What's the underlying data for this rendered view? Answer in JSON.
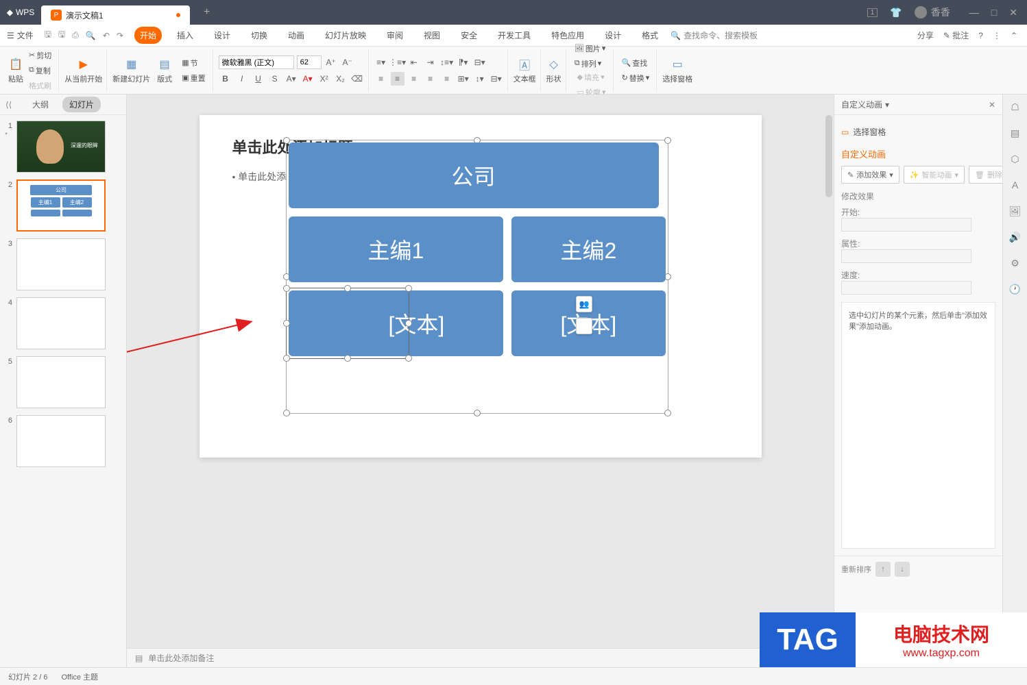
{
  "titlebar": {
    "app_name": "WPS",
    "tab_title": "演示文稿1",
    "user_name": "香香"
  },
  "menubar": {
    "file": "文件",
    "tabs": [
      "开始",
      "插入",
      "设计",
      "切换",
      "动画",
      "幻灯片放映",
      "审阅",
      "视图",
      "安全",
      "开发工具",
      "特色应用",
      "设计",
      "格式"
    ],
    "search_placeholder": "查找命令、搜索模板",
    "share": "分享",
    "comment": "批注"
  },
  "ribbon": {
    "paste": "粘贴",
    "cut": "剪切",
    "copy": "复制",
    "format_painter": "格式刷",
    "from_current": "从当前开始",
    "new_slide": "新建幻灯片",
    "layout": "版式",
    "section": "节",
    "reset": "重置",
    "font_name": "微软雅黑 (正文)",
    "font_size": "62",
    "textbox": "文本框",
    "shape": "形状",
    "picture": "图片",
    "arrange": "排列",
    "fill": "填充",
    "outline": "轮廓",
    "find": "查找",
    "replace": "替换",
    "select_pane": "选择窗格"
  },
  "slide_panel": {
    "outline": "大纲",
    "slides": "幻灯片",
    "thumb1_caption": "深邃的眼眸",
    "thumb2": {
      "box1": "公司",
      "box2": "主编1",
      "box3": "主编2"
    }
  },
  "slide": {
    "title_placeholder": "单击此处添加标题",
    "bullet_placeholder": "• 单击此处添",
    "box_company": "公司",
    "box_editor1": "主编1",
    "box_editor2": "主编2",
    "box_text": "[文本]"
  },
  "notes": {
    "placeholder": "单击此处添加备注"
  },
  "right_panel": {
    "title": "自定义动画",
    "select_pane": "选择窗格",
    "section": "自定义动画",
    "add_effect": "添加效果",
    "smart_anim": "智能动画",
    "delete": "删除",
    "modify": "修改效果",
    "start": "开始:",
    "property": "属性:",
    "speed": "速度:",
    "hint": "选中幻灯片的某个元素，然后单击\"添加效果\"添加动画。",
    "reorder": "重新排序"
  },
  "statusbar": {
    "slide_info": "幻灯片 2 / 6",
    "theme": "Office 主题"
  },
  "watermark": {
    "tag": "TAG",
    "cn": "电脑技术网",
    "url": "www.tagxp.com"
  }
}
